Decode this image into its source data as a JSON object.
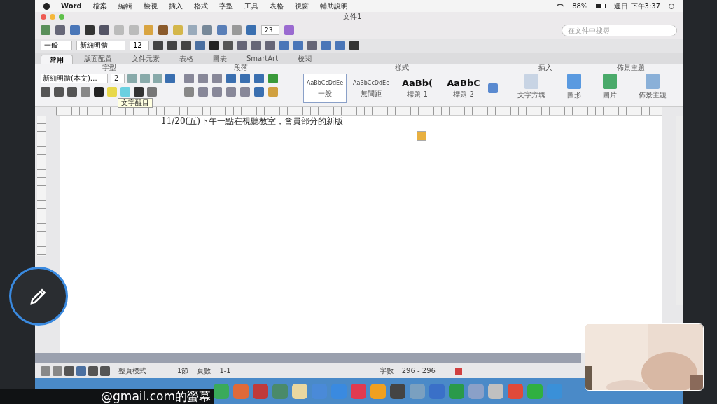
{
  "menu_bar": {
    "items": [
      "Word",
      "檔案",
      "編輯",
      "檢視",
      "插入",
      "格式",
      "字型",
      "工具",
      "表格",
      "視窗",
      "輔助說明"
    ],
    "battery": "88%",
    "clock": "週日 下午3:37"
  },
  "window": {
    "title": "文件1"
  },
  "toolbar": {
    "zoom": "23",
    "search": {
      "placeholder": "在文件中搜尋"
    }
  },
  "format_bar": {
    "style": "一般",
    "font": "新細明體",
    "size": "12"
  },
  "ribbon_tabs": [
    {
      "label": "常用",
      "selected": true
    },
    {
      "label": "版面配置",
      "selected": false
    },
    {
      "label": "文件元素",
      "selected": false
    },
    {
      "label": "表格",
      "selected": false
    },
    {
      "label": "圖表",
      "selected": false
    },
    {
      "label": "SmartArt",
      "selected": false
    },
    {
      "label": "校閱",
      "selected": false
    }
  ],
  "ribbon": {
    "groups": [
      "字型",
      "段落",
      "樣式",
      "插入",
      "佈景主題"
    ],
    "font_name": "新細明體(本文)…",
    "font_size": "2",
    "styles": [
      {
        "sample": "AaBbCcDdEe",
        "name": "一般",
        "selected": true
      },
      {
        "sample": "AaBbCcDdEe",
        "name": "無間距",
        "selected": false
      },
      {
        "sample": "AaBb(",
        "name": "標題 1",
        "selected": false
      },
      {
        "sample": "AaBbC",
        "name": "標題 2",
        "selected": false
      }
    ],
    "insert": [
      "文字方塊",
      "圖形",
      "圖片",
      "佈景主題"
    ],
    "tooltip": "文字醒目"
  },
  "document": {
    "lines": [
      "11/20(五)下午一點在視聽教室，會員部分的新版"
    ]
  },
  "status_bar": {
    "view": "整頁模式",
    "section": "1節",
    "page_label": "頁數",
    "pages": "1-1",
    "words_label": "字數",
    "words": "296 - 296"
  },
  "caption": "@gmail.com的螢幕"
}
